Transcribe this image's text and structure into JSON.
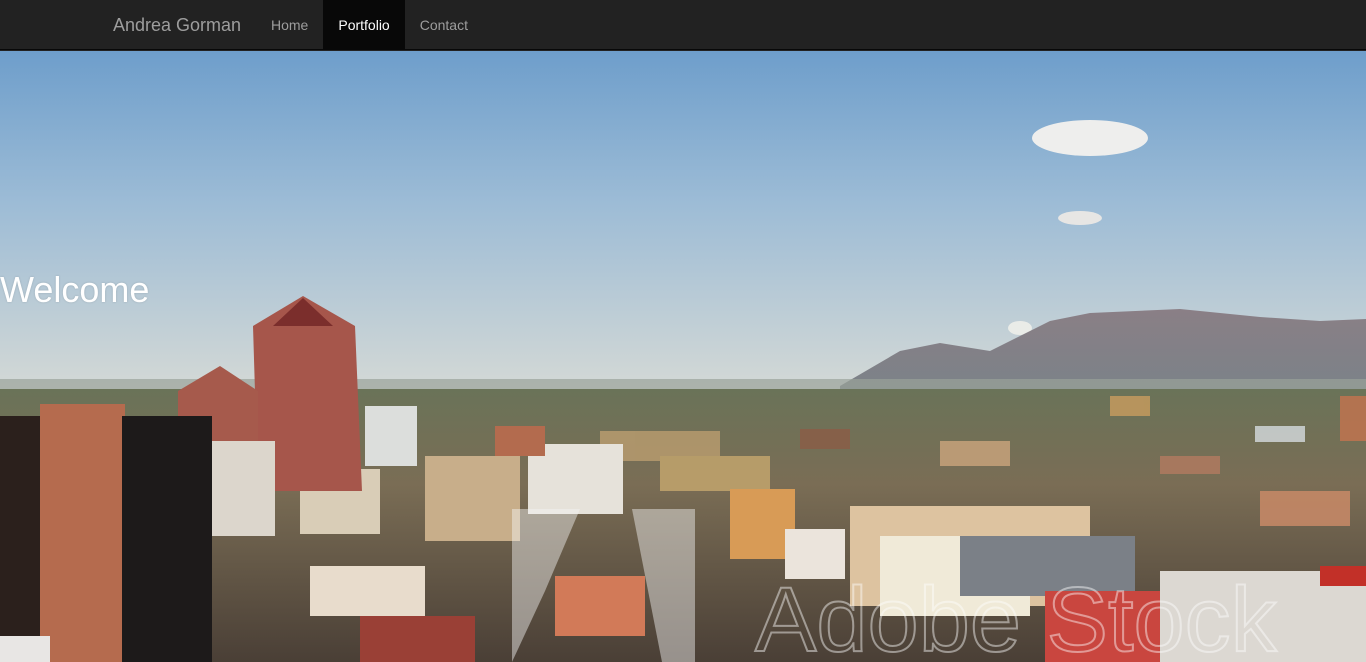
{
  "navbar": {
    "brand": "Andrea Gorman",
    "items": [
      {
        "label": "Home",
        "active": false
      },
      {
        "label": "Portfolio",
        "active": true
      },
      {
        "label": "Contact",
        "active": false
      }
    ]
  },
  "hero": {
    "heading": "Welcome",
    "watermark": "Adobe Stock",
    "image": "aerial-city-skyline-with-mountains"
  },
  "colors": {
    "navbar_bg": "#222222",
    "nav_text": "#9d9d9d",
    "nav_active_bg": "#080808",
    "nav_active_text": "#ffffff",
    "sky_top": "#6f9fcc",
    "sky_horizon": "#c9d6df"
  }
}
